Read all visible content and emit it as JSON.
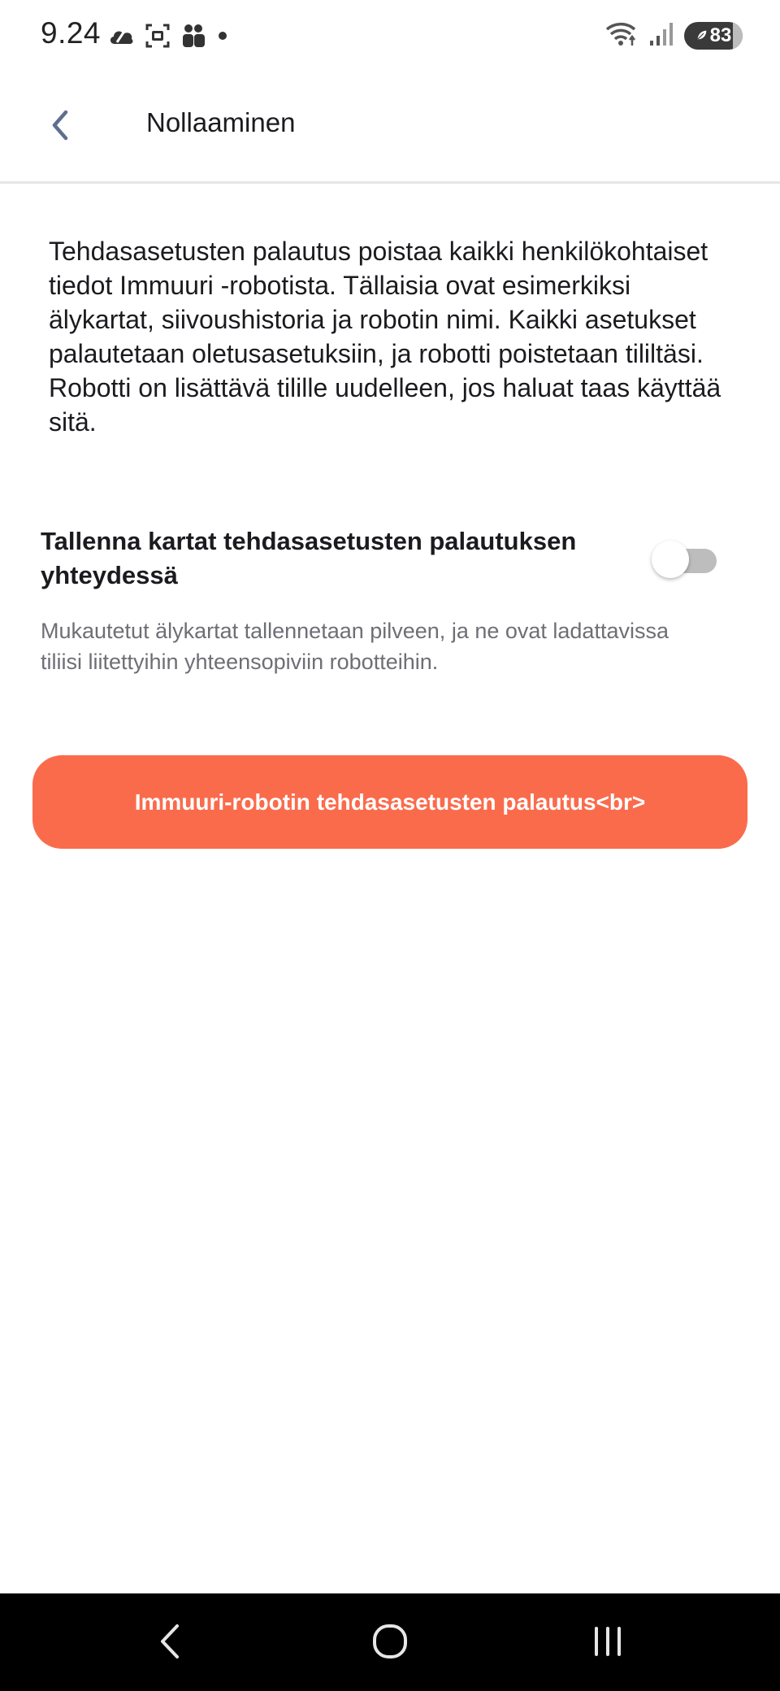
{
  "status_bar": {
    "time": "9.24",
    "battery_level": "83",
    "left_icons": [
      "cloud-icon",
      "screenshot-icon",
      "people-icon",
      "dot-icon"
    ],
    "right_icons": [
      "wifi-icon",
      "signal-icon",
      "battery-icon"
    ]
  },
  "header": {
    "title": "Nollaaminen",
    "back_icon": "chevron-left-icon"
  },
  "description": "Tehdasasetusten palautus poistaa kaikki henkilökohtaiset tiedot Immuuri -robotista. Tällaisia ovat esimerkiksi älykartat, siivoushistoria ja robotin nimi. Kaikki asetukset palautetaan oletusasetuksiin, ja robotti poistetaan tililtäsi. Robotti on lisättävä tilille uudelleen, jos haluat taas käyttää sitä.",
  "save_maps_setting": {
    "title": "Tallenna kartat tehdasasetusten palautuksen yhteydessä",
    "subtitle": "Mukautetut älykartat tallennetaan pilveen, ja ne ovat ladattavissa tiliisi liitettyihin yhteensopiviin robotteihin.",
    "enabled": false
  },
  "reset_button": {
    "label": "Immuuri-robotin tehdasasetusten palautus<br>"
  },
  "nav_bar": {
    "icons": [
      "back-icon",
      "home-icon",
      "recents-icon"
    ]
  },
  "colors": {
    "accent": "#fa6b4c",
    "back_chevron": "#5f6f8e",
    "text_primary": "#1b1b1f",
    "text_secondary": "#6e6e76",
    "toggle_off": "#bdbdbd"
  }
}
